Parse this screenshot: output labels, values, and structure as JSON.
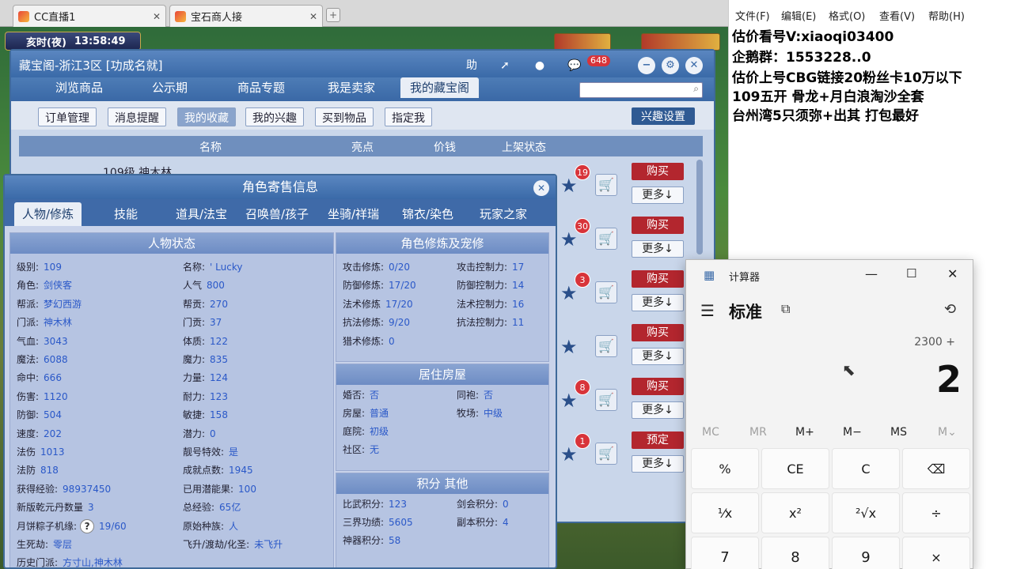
{
  "browser": {
    "tabs": [
      {
        "label": "CC直播1"
      },
      {
        "label": "宝石商人接"
      }
    ],
    "new_tab": "+"
  },
  "game": {
    "time_label": "亥时(夜)",
    "clock": "13:58:49"
  },
  "cbg": {
    "title": "藏宝阁-浙江3区 [功成名就]",
    "title_buttons": {
      "help": "助",
      "badge": "648"
    },
    "nav": [
      "浏览商品",
      "公示期",
      "商品专题",
      "我是卖家",
      "我的藏宝阁"
    ],
    "subnav": [
      "订单管理",
      "消息提醒",
      "我的收藏",
      "我的兴趣",
      "买到物品",
      "指定我"
    ],
    "interest_settings": "兴趣设置",
    "table_headers": [
      "名称",
      "亮点",
      "价钱",
      "上架状态"
    ],
    "rows": [
      {
        "count": "19",
        "action": "购买",
        "more": "更多↓"
      },
      {
        "count": "30",
        "action": "购买",
        "more": "更多↓"
      },
      {
        "count": "3",
        "action": "购买",
        "more": "更多↓"
      },
      {
        "count": "",
        "action": "购买",
        "more": "更多↓"
      },
      {
        "count": "8",
        "action": "购买",
        "more": "更多↓"
      },
      {
        "count": "1",
        "action": "预定",
        "more": "更多↓"
      }
    ],
    "first_row_name": "109级  神木林"
  },
  "role": {
    "title": "角色寄售信息",
    "tabs": [
      "人物/修炼",
      "技能",
      "道具/法宝",
      "召唤兽/孩子",
      "坐骑/祥瑞",
      "锦衣/染色",
      "玩家之家"
    ],
    "status_title": "人物状态",
    "left_col": [
      [
        "级别:",
        "109"
      ],
      [
        "角色:",
        "剑侠客"
      ],
      [
        "帮派:",
        "梦幻西游"
      ],
      [
        "门派:",
        "神木林"
      ],
      [
        "气血:",
        "3043"
      ],
      [
        "魔法:",
        "6088"
      ],
      [
        "命中:",
        "666"
      ],
      [
        "伤害:",
        "1120"
      ],
      [
        "防御:",
        "504"
      ],
      [
        "速度:",
        "202"
      ],
      [
        "法伤",
        "1013"
      ],
      [
        "法防",
        "818"
      ],
      [
        "获得经验:",
        "98937450"
      ],
      [
        "新版乾元丹数量",
        "3"
      ],
      [
        "月饼粽子机缘:",
        "19/60"
      ],
      [
        "生死劫:",
        "零层"
      ],
      [
        "历史门派:",
        "方寸山,神木林"
      ]
    ],
    "mid_col": [
      [
        "名称:",
        "' Lucky"
      ],
      [
        "人气",
        "800"
      ],
      [
        "帮贡:",
        "270"
      ],
      [
        "门贡:",
        "37"
      ],
      [
        "体质:",
        "122"
      ],
      [
        "魔力:",
        "835"
      ],
      [
        "力量:",
        "124"
      ],
      [
        "耐力:",
        "123"
      ],
      [
        "敏捷:",
        "158"
      ],
      [
        "潜力:",
        "0"
      ],
      [
        "靓号特效:",
        "是"
      ],
      [
        "成就点数:",
        "1945"
      ],
      [
        "已用潜能果:",
        "100"
      ],
      [
        "总经验:",
        "65亿"
      ],
      [
        "原始种族:",
        "人"
      ],
      [
        "飞升/渡劫/化圣:",
        "未飞升"
      ]
    ],
    "cultivation_title": "角色修炼及宠修",
    "cultivation": [
      [
        "攻击修炼:",
        "0/20",
        "攻击控制力:",
        "17"
      ],
      [
        "防御修炼:",
        "17/20",
        "防御控制力:",
        "14"
      ],
      [
        "法术修炼",
        "17/20",
        "法术控制力:",
        "16"
      ],
      [
        "抗法修炼:",
        "9/20",
        "抗法控制力:",
        "11"
      ],
      [
        "猎术修炼:",
        "0",
        "",
        ""
      ]
    ],
    "house_title": "居住房屋",
    "house": [
      [
        "婚否:",
        "否",
        "同袍:",
        "否"
      ],
      [
        "房屋:",
        "普通",
        "牧场:",
        "中级"
      ],
      [
        "庭院:",
        "初级",
        "",
        ""
      ],
      [
        "社区:",
        "无",
        "",
        ""
      ]
    ],
    "score_title": "积分 其他",
    "score": [
      [
        "比武积分:",
        "123",
        "剑会积分:",
        "0"
      ],
      [
        "三界功绩:",
        "5605",
        "副本积分:",
        "4"
      ],
      [
        "神器积分:",
        "58",
        "",
        ""
      ]
    ]
  },
  "notepad": {
    "menu": [
      "文件(F)",
      "编辑(E)",
      "格式(O)",
      "查看(V)",
      "帮助(H)"
    ],
    "lines": [
      "估价看号V:xiaoqi03400",
      "企鹅群：1553228..0",
      "估价上号CBG链接20粉丝卡10万以下",
      "109五开 骨龙+月白浪淘沙全套",
      "台州湾5只须弥+出其 打包最好"
    ]
  },
  "calculator": {
    "title": "计算器",
    "mode": "标准",
    "expression": "2300 +",
    "display": "2",
    "memory": [
      "MC",
      "MR",
      "M+",
      "M−",
      "MS",
      "M⌄"
    ],
    "keys": [
      "%",
      "CE",
      "C",
      "⌫",
      "¹⁄x",
      "x²",
      "²√x",
      "÷",
      "7",
      "8",
      "9",
      "×"
    ]
  }
}
